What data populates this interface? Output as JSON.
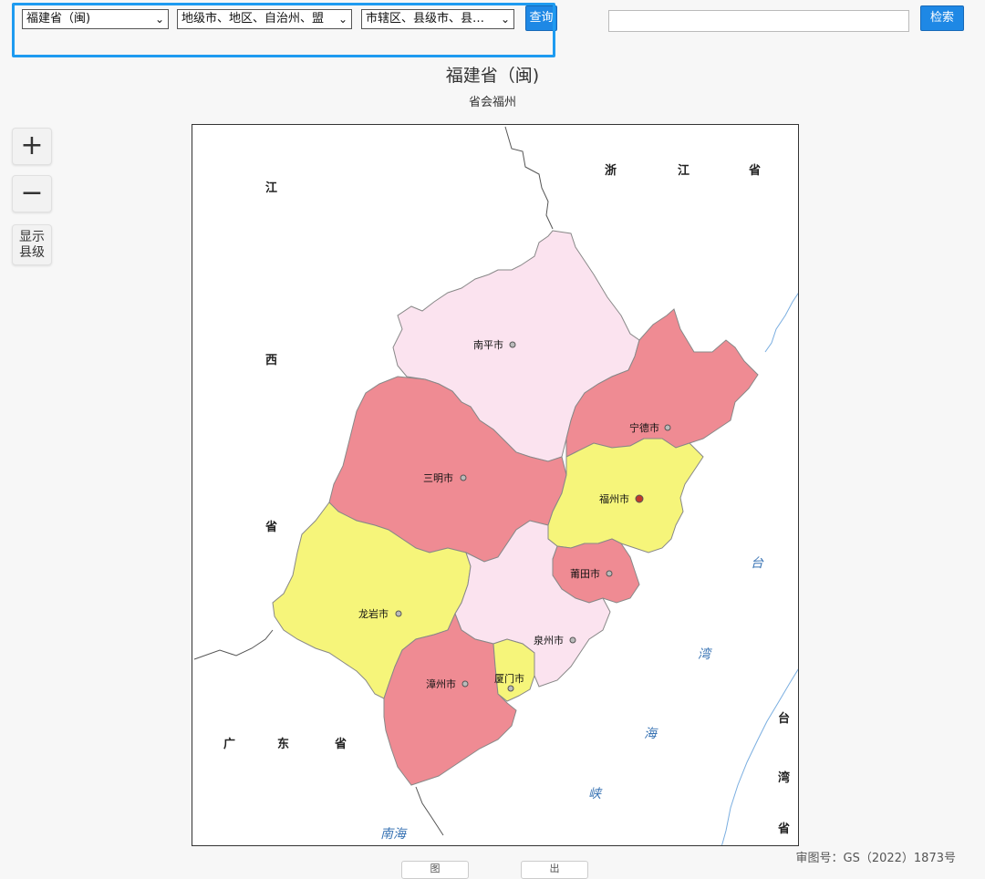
{
  "toolbar": {
    "province_select": "福建省（闽)",
    "city_select": "地级市、地区、自治州、盟",
    "county_select": "市辖区、县级市、县…",
    "query_button": "查询",
    "search_placeholder": "",
    "search_button": "检索"
  },
  "header": {
    "title": "福建省（闽)",
    "subtitle": "省会福州"
  },
  "zoom_controls": {
    "zoom_in": "+",
    "zoom_out": "−",
    "show_county_line1": "显示",
    "show_county_line2": "县级"
  },
  "map": {
    "cities": [
      {
        "name": "南平市",
        "color": "#fbe3ef"
      },
      {
        "name": "宁德市",
        "color": "#ef8b93"
      },
      {
        "name": "三明市",
        "color": "#ef8b93"
      },
      {
        "name": "福州市",
        "color": "#f6f57a"
      },
      {
        "name": "莆田市",
        "color": "#ef8b93"
      },
      {
        "name": "龙岩市",
        "color": "#f6f57a"
      },
      {
        "name": "泉州市",
        "color": "#fbe3ef"
      },
      {
        "name": "漳州市",
        "color": "#ef8b93"
      },
      {
        "name": "厦门市",
        "color": "#f6f57a"
      }
    ],
    "neighbor_labels": {
      "zhe": "浙",
      "jiang1": "江",
      "sheng1": "省",
      "jiang2": "江",
      "xi": "西",
      "sheng2": "省",
      "guang": "广",
      "dong": "东",
      "sheng3": "省",
      "tai1": "台",
      "wan1": "湾",
      "sheng4": "省"
    },
    "sea_labels": {
      "tai": "台",
      "wan": "湾",
      "hai": "海",
      "xia": "峡",
      "nanhai": "南海"
    },
    "colors": {
      "sea_text": "#3a74b4",
      "border": "#333333"
    }
  },
  "footer": {
    "approval": "审图号：GS（2022）1873号",
    "btn_left": "图",
    "btn_right": "出"
  }
}
